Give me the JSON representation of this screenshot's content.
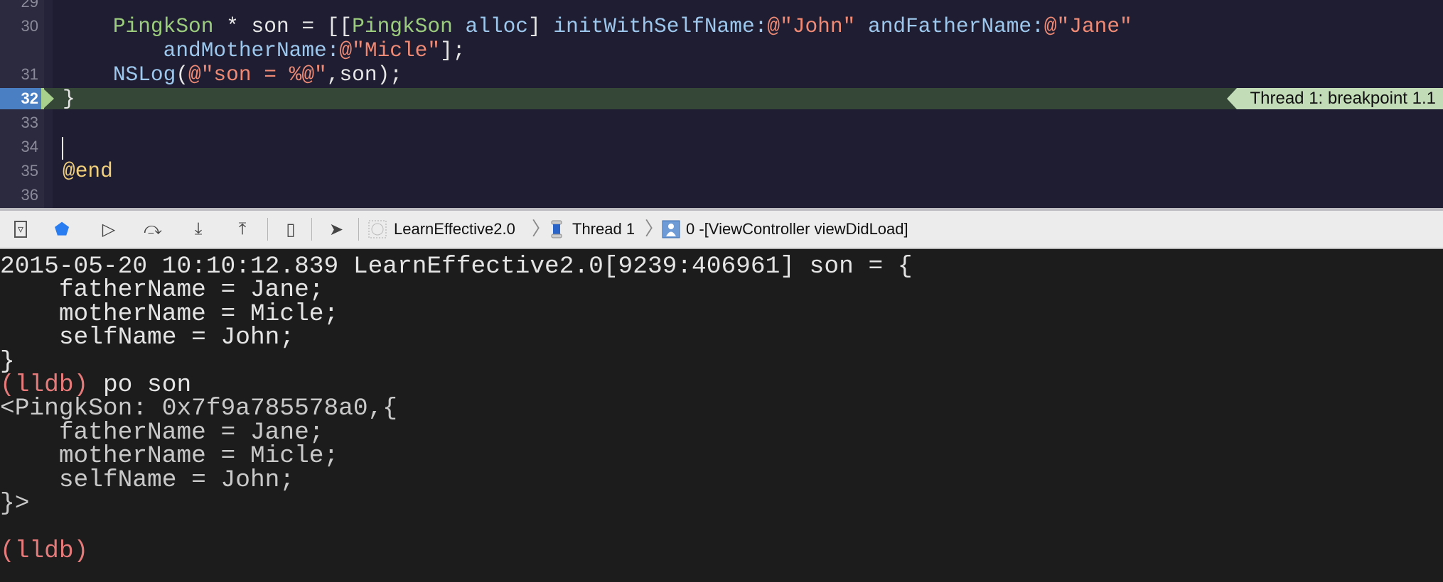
{
  "editor": {
    "lines": [
      {
        "num": "29",
        "tokens": []
      },
      {
        "num": "30",
        "tokens": [
          {
            "t": "    ",
            "c": "plain"
          },
          {
            "t": "PingkSon",
            "c": "type"
          },
          {
            "t": " * son = [[",
            "c": "plain"
          },
          {
            "t": "PingkSon",
            "c": "type"
          },
          {
            "t": " ",
            "c": "plain"
          },
          {
            "t": "alloc",
            "c": "meth"
          },
          {
            "t": "] ",
            "c": "plain"
          },
          {
            "t": "initWithSelfName:",
            "c": "meth"
          },
          {
            "t": "@\"John\"",
            "c": "str"
          },
          {
            "t": " ",
            "c": "plain"
          },
          {
            "t": "andFatherName:",
            "c": "meth"
          },
          {
            "t": "@\"Jane\"",
            "c": "str"
          }
        ]
      },
      {
        "num": "",
        "tokens": [
          {
            "t": "        ",
            "c": "plain"
          },
          {
            "t": "andMotherName:",
            "c": "meth"
          },
          {
            "t": "@\"Micle\"",
            "c": "str"
          },
          {
            "t": "];",
            "c": "plain"
          }
        ]
      },
      {
        "num": "31",
        "tokens": [
          {
            "t": "    ",
            "c": "plain"
          },
          {
            "t": "NSLog",
            "c": "meth"
          },
          {
            "t": "(",
            "c": "plain"
          },
          {
            "t": "@\"son = %@\"",
            "c": "str"
          },
          {
            "t": ",son);",
            "c": "plain"
          }
        ]
      },
      {
        "num": "32",
        "current": true,
        "tokens": [
          {
            "t": "}",
            "c": "plain"
          }
        ]
      },
      {
        "num": "33",
        "tokens": []
      },
      {
        "num": "34",
        "tokens": []
      },
      {
        "num": "35",
        "tokens": [
          {
            "t": "@end",
            "c": "kw"
          }
        ]
      },
      {
        "num": "36",
        "tokens": []
      }
    ],
    "breakpoint_label": "Thread 1: breakpoint 1.1"
  },
  "debug_bar": {
    "buttons": [
      {
        "name": "hide-debug-area-button",
        "glyph": "▿"
      },
      {
        "name": "breakpoints-toggle-button",
        "glyph": "⬟"
      },
      {
        "name": "continue-button",
        "glyph": "▷"
      },
      {
        "name": "step-over-button",
        "glyph": "⤼"
      },
      {
        "name": "step-into-button",
        "glyph": "⤓"
      },
      {
        "name": "step-out-button",
        "glyph": "⤒"
      },
      {
        "name": "view-hierarchy-button",
        "glyph": "▯"
      },
      {
        "name": "simulate-location-button",
        "glyph": "➤"
      }
    ],
    "breadcrumbs": {
      "app": "LearnEffective2.0",
      "thread": "Thread 1",
      "frame": "0 -[ViewController viewDidLoad]"
    }
  },
  "console": {
    "lines": [
      {
        "type": "log",
        "text": "2015-05-20 10:10:12.839 LearnEffective2.0[9239:406961] son = {"
      },
      {
        "type": "log",
        "text": "    fatherName = Jane;"
      },
      {
        "type": "log",
        "text": "    motherName = Micle;"
      },
      {
        "type": "log",
        "text": "    selfName = John;"
      },
      {
        "type": "log",
        "text": "}"
      },
      {
        "type": "cmd",
        "prompt": "(lldb)",
        "text": " po son"
      },
      {
        "type": "out",
        "text": "<PingkSon: 0x7f9a785578a0,{"
      },
      {
        "type": "out",
        "text": "    fatherName = Jane;"
      },
      {
        "type": "out",
        "text": "    motherName = Micle;"
      },
      {
        "type": "out",
        "text": "    selfName = John;"
      },
      {
        "type": "out",
        "text": "}>"
      },
      {
        "type": "out",
        "text": ""
      },
      {
        "type": "cmd",
        "prompt": "(lldb)",
        "text": ""
      }
    ]
  },
  "colors": {
    "editor_bg": "#1e1d31",
    "current_line_bg": "#354737",
    "breakpoint_label_bg": "#c3dcb8",
    "type": "#9ccc7d",
    "method": "#9dc7ec",
    "string": "#ee8a75",
    "keyword": "#f1cf7c",
    "lldb_prompt": "#e57a7a",
    "console_bg": "#1c1c1c"
  }
}
